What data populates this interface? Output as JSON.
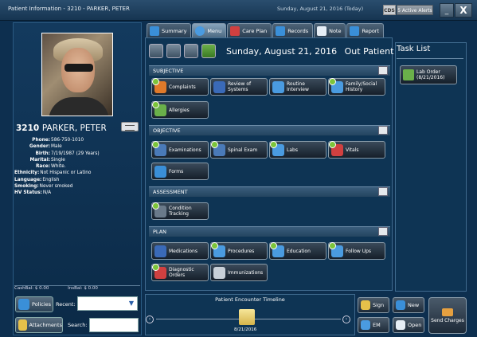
{
  "window": {
    "title": "Patient Information - 3210 - PARKER, PETER",
    "date": "Sunday, August 21, 2016 (Today)",
    "cds": "CDS",
    "alerts": "5 Active Alerts",
    "minimize": "_",
    "close": "X"
  },
  "patient": {
    "id": "3210",
    "name": "PARKER, PETER",
    "fields": [
      {
        "label": "Phone:",
        "value": "586-750-1010"
      },
      {
        "label": "Gender:",
        "value": "Male"
      },
      {
        "label": "Birth:",
        "value": "7/19/1987 (29 Years)"
      },
      {
        "label": "Marital:",
        "value": "Single"
      },
      {
        "label": "Race:",
        "value": "White."
      },
      {
        "label": "Ethnicity:",
        "value": "Not Hispanic or Latino"
      },
      {
        "label": "Language:",
        "value": "English"
      },
      {
        "label": "Smoking:",
        "value": "Never smoked"
      },
      {
        "label": "HV Status:",
        "value": "N/A"
      }
    ],
    "cash_bal": "CashBal: $ 0.00",
    "ins_bal": "InsBal: $ 0.00"
  },
  "left_actions": {
    "policies": "Policies",
    "recent_label": "Recent:",
    "attachments": "Attachments",
    "search_label": "Search:"
  },
  "tabs": [
    {
      "label": "Summary",
      "icon": "summary-icon",
      "color": "#3a8fd8"
    },
    {
      "label": "Menu",
      "icon": "menu-icon",
      "color": "#4a9be0"
    },
    {
      "label": "Care Plan",
      "icon": "care-plan-icon",
      "color": "#d04040"
    },
    {
      "label": "Records",
      "icon": "records-icon",
      "color": "#3a8fd8"
    },
    {
      "label": "Note",
      "icon": "note-icon",
      "color": "#e6eef6"
    },
    {
      "label": "Report",
      "icon": "report-icon",
      "color": "#3a8fd8"
    }
  ],
  "header": {
    "date": "Sunday, August 21, 2016",
    "visit_type": "Out Patient"
  },
  "sections": {
    "subjective": {
      "title": "SUBJECTIVE",
      "buttons": [
        "Complaints",
        "Review of Systems",
        "Routine Interview",
        "Family/Social History",
        "Allergies"
      ]
    },
    "objective": {
      "title": "OBJECTIVE",
      "buttons": [
        "Examinations",
        "Spinal Exam",
        "Labs",
        "Vitals",
        "Forms"
      ]
    },
    "assessment": {
      "title": "ASSESSMENT",
      "buttons": [
        "Condition Tracking"
      ]
    },
    "plan": {
      "title": "PLAN",
      "buttons": [
        "Medications",
        "Procedures",
        "Education",
        "Follow Ups",
        "Diagnostic Orders",
        "Immunizations"
      ]
    }
  },
  "task_list": {
    "title": "Task List",
    "items": [
      {
        "label": "Lab Order",
        "date": "(8/21/2016)"
      }
    ]
  },
  "timeline": {
    "title": "Patient Encounter Timeline",
    "date": "8/21/2016"
  },
  "actions": {
    "sign": "Sign",
    "new": "New",
    "em": "EM",
    "open": "Open",
    "send_charges": "Send Charges"
  },
  "colors": {
    "background": "#0d2f4f",
    "panel": "#0e3454",
    "check_green": "#7cc43a"
  }
}
